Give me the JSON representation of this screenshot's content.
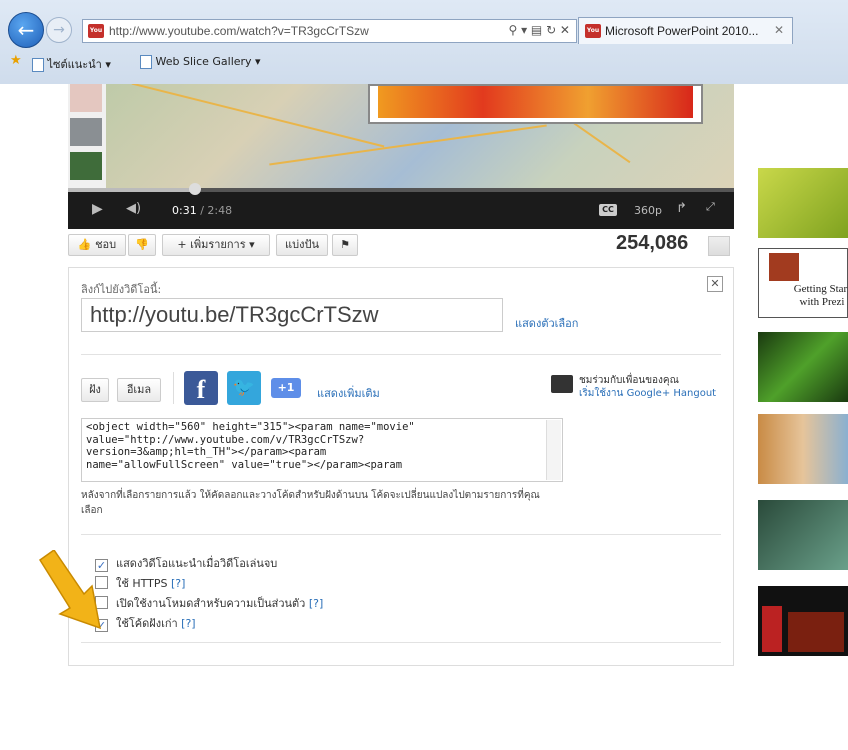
{
  "browser": {
    "url": "http://www.youtube.com/watch?v=TR3gcCrTSzw",
    "tab_title": "Microsoft PowerPoint 2010...",
    "favorites": [
      "ไซต์แนะนำ ▾",
      "Web Slice Gallery ▾"
    ],
    "yt_badge": "You"
  },
  "player": {
    "current_time": "0:31",
    "total_time": "/ 2:48",
    "quality": "360p",
    "cc_label": "CC",
    "progress": 0.19
  },
  "actions": {
    "like": "ชอบ",
    "add_to": "+ เพิ่มรายการ ▾",
    "share": "แบ่งปัน",
    "views": "254,086"
  },
  "share": {
    "link_label": "ลิงก์ไปยังวิดีโอนี้:",
    "short_url": "http://youtu.be/TR3gcCrTSzw",
    "show_options": "แสดงตัวเลือก",
    "embed_button": "ฝัง",
    "email_button": "อีเมล",
    "gplus_label": "+1",
    "show_more": "แสดงเพิ่มเติม",
    "hangout_line1": "ชมร่วมกับเพื่อนของคุณ",
    "hangout_line2": "เริ่มใช้งาน Google+ Hangout",
    "embed_code": "<object width=\"560\" height=\"315\"><param name=\"movie\"\nvalue=\"http://www.youtube.com/v/TR3gcCrTSzw?\nversion=3&amp;hl=th_TH\"></param><param\nname=\"allowFullScreen\" value=\"true\"></param><param",
    "embed_note": "หลังจากที่เลือกรายการแล้ว ให้คัดลอกและวางโค้ดสำหรับฝังด้านบน โค้ดจะเปลี่ยนแปลงไปตามรายการที่คุณเลือก",
    "options": [
      {
        "label": "แสดงวิดีโอแนะนำเมื่อวิดีโอเล่นจบ",
        "help": "",
        "checked": true
      },
      {
        "label": "ใช้ HTTPS",
        "help": "[?]",
        "checked": false
      },
      {
        "label": "เปิดใช้งานโหมดสำหรับความเป็นส่วนตัว",
        "help": "[?]",
        "checked": false
      },
      {
        "label": "ใช้โค้ดฝังเก่า",
        "help": "[?]",
        "checked": true
      }
    ]
  },
  "sidebar": {
    "thumb_text": "Getting Start with Prezi"
  },
  "colors": {
    "link": "#2a6fb8",
    "facebook": "#3b5998",
    "twitter": "#34a6dc",
    "arrow": "#f2b318"
  }
}
